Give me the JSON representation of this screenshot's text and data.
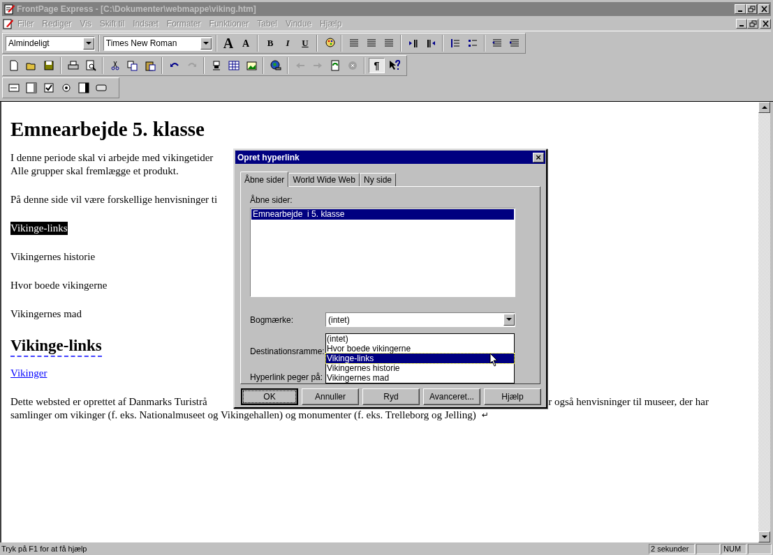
{
  "window": {
    "title": "FrontPage Express - [C:\\Dokumenter\\webmappe\\viking.htm]"
  },
  "menu": [
    {
      "label": "Filer",
      "disabled": true
    },
    {
      "label": "Rediger",
      "disabled": true
    },
    {
      "label": "Vis",
      "disabled": true
    },
    {
      "label": "Skift til",
      "disabled": true
    },
    {
      "label": "Indsæt",
      "disabled": true
    },
    {
      "label": "Formater",
      "disabled": true
    },
    {
      "label": "Funktioner",
      "disabled": true
    },
    {
      "label": "Tabel",
      "disabled": true
    },
    {
      "label": "Vindue",
      "disabled": true
    },
    {
      "label": "Hjælp",
      "disabled": true
    }
  ],
  "format_toolbar": {
    "style": "Almindeligt",
    "font": "Times New Roman",
    "grow_font": "A",
    "shrink_font": "A",
    "bold": "B",
    "italic": "I",
    "underline": "U"
  },
  "standard_toolbar": {
    "marks_button": {
      "symbol": "¶",
      "pressed": true
    }
  },
  "document": {
    "blocks": [
      {
        "kind": "heading",
        "lines": [
          [
            "Emnearbejde 5. klasse"
          ]
        ]
      },
      {
        "kind": "paragraph",
        "lines": [
          [
            "I denne periode skal vi arbejde med vikingetider"
          ],
          [
            "Alle grupper skal fremlægge et produkt."
          ]
        ]
      },
      {
        "kind": "paragraph",
        "lines": [
          [
            "På denne side vil være forskellige henvisninger ti"
          ]
        ]
      },
      {
        "kind": "paragraph",
        "selected": true,
        "lines": [
          [
            "Vikinge-links"
          ]
        ]
      },
      {
        "kind": "paragraph",
        "lines": [
          [
            "Vikingernes historie"
          ]
        ]
      },
      {
        "kind": "paragraph",
        "lines": [
          [
            "Hvor boede vikingerne"
          ]
        ]
      },
      {
        "kind": "paragraph",
        "lines": [
          [
            "Vikingernes mad"
          ]
        ]
      },
      {
        "kind": "bookmark",
        "lines": [
          [
            "Vikinge-links"
          ]
        ]
      },
      {
        "kind": "link",
        "lines": [
          [
            "Vikinger"
          ]
        ]
      },
      {
        "kind": "paragraph",
        "lines": [
          [
            "Dette websted er oprettet af Danmarks Turistrå",
            "r også henvisninger til museer, der har"
          ],
          [
            "samlinger om vikinger (f. eks. Nationalmuseet og Vikingehallen) og monumenter (f. eks. Trelleborg og Jelling)"
          ]
        ],
        "end_mark": "↵"
      }
    ]
  },
  "dialog": {
    "title": "Opret hyperlink",
    "close": "×",
    "tabs": [
      {
        "label": "Åbne sider",
        "selected": true
      },
      {
        "label": "World Wide Web",
        "selected": false
      },
      {
        "label": "Ny side",
        "selected": false
      }
    ],
    "pages_label": "Åbne sider:",
    "pages": [
      {
        "label": "Emnearbejde  i 5. klasse",
        "selected": true
      }
    ],
    "bookmark_label": "Bogmærke:",
    "bookmark_value": "(intet)",
    "bookmark_options": [
      {
        "label": "(intet)",
        "selected": false
      },
      {
        "label": "Hvor boede vikingerne",
        "selected": false
      },
      {
        "label": "Vikinge-links",
        "selected": true
      },
      {
        "label": "Vikingernes historie",
        "selected": false
      },
      {
        "label": "Vikingernes mad",
        "selected": false
      }
    ],
    "frame_label": "Destinationsramme:",
    "target_label": "Hyperlink peger på:",
    "buttons": [
      {
        "label": "OK",
        "default": true
      },
      {
        "label": "Annuller",
        "default": false
      },
      {
        "label": "Ryd",
        "default": false
      },
      {
        "label": "Avanceret...",
        "default": false
      },
      {
        "label": "Hjælp",
        "default": false
      }
    ]
  },
  "status_bar": {
    "text": "Tryk på F1 for at få hjælp",
    "panels": [
      "2 sekunder",
      "NUM"
    ]
  }
}
